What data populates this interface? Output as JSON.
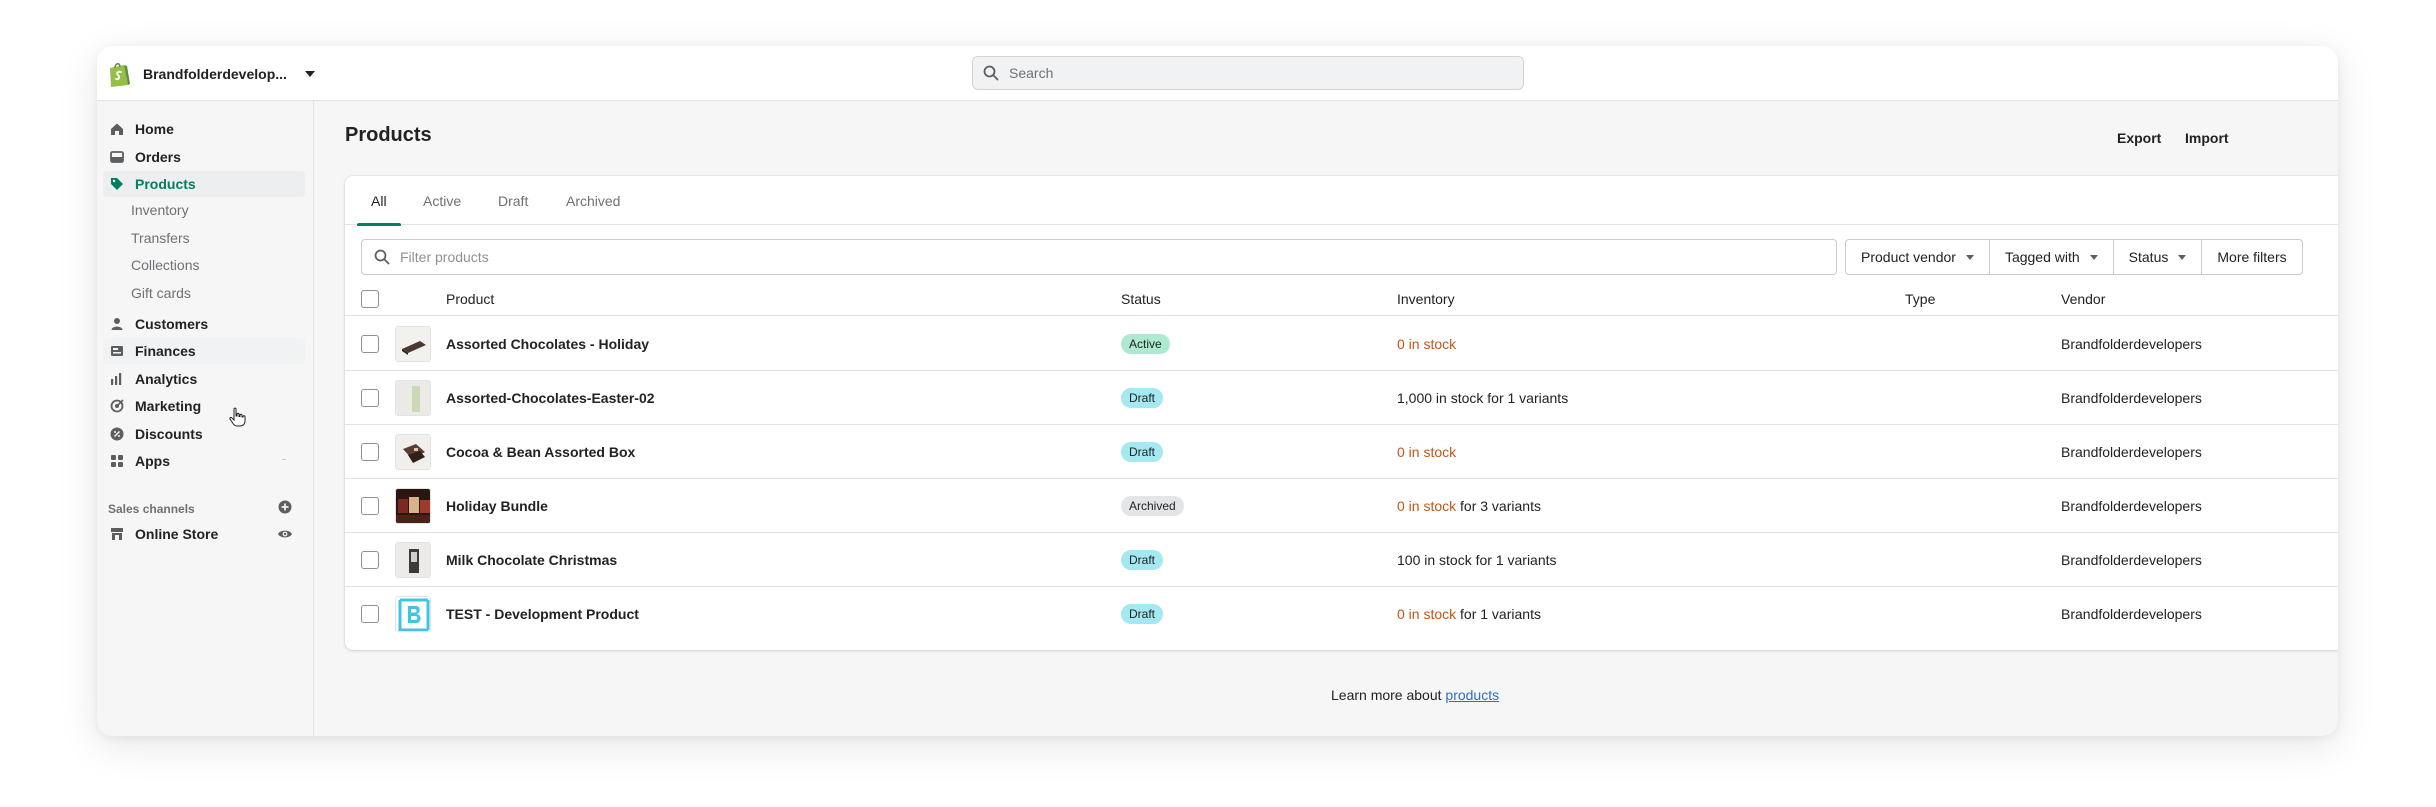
{
  "topbar": {
    "store_name": "Brandfolderdevelop...",
    "search_placeholder": "Search"
  },
  "sidebar": {
    "items": [
      {
        "label": "Home",
        "icon": "home-icon"
      },
      {
        "label": "Orders",
        "icon": "orders-icon"
      },
      {
        "label": "Products",
        "icon": "tag-icon",
        "active": true
      },
      {
        "label": "Customers",
        "icon": "person-icon"
      },
      {
        "label": "Finances",
        "icon": "finances-icon"
      },
      {
        "label": "Analytics",
        "icon": "bar-chart-icon"
      },
      {
        "label": "Marketing",
        "icon": "target-icon"
      },
      {
        "label": "Discounts",
        "icon": "discount-icon"
      },
      {
        "label": "Apps",
        "icon": "apps-icon"
      }
    ],
    "product_subitems": [
      "Inventory",
      "Transfers",
      "Collections",
      "Gift cards"
    ],
    "sales_channels_label": "Sales channels",
    "online_store_label": "Online Store"
  },
  "page": {
    "title": "Products",
    "export_label": "Export",
    "import_label": "Import"
  },
  "tabs": [
    "All",
    "Active",
    "Draft",
    "Archived"
  ],
  "filters": {
    "placeholder": "Filter products",
    "buttons": [
      "Product vendor",
      "Tagged with",
      "Status",
      "More filters"
    ]
  },
  "table": {
    "headers": {
      "product": "Product",
      "status": "Status",
      "inventory": "Inventory",
      "type": "Type",
      "vendor": "Vendor"
    },
    "rows": [
      {
        "name": "Assorted Chocolates - Holiday",
        "status": "Active",
        "inv_warn": "0 in stock",
        "inv_rest": "",
        "vendor": "Brandfolderdevelopers"
      },
      {
        "name": "Assorted-Chocolates-Easter-02",
        "status": "Draft",
        "inv_warn": "",
        "inv_rest": "1,000 in stock for 1 variants",
        "vendor": "Brandfolderdevelopers"
      },
      {
        "name": "Cocoa & Bean Assorted Box",
        "status": "Draft",
        "inv_warn": "0 in stock",
        "inv_rest": "",
        "vendor": "Brandfolderdevelopers"
      },
      {
        "name": "Holiday Bundle",
        "status": "Archived",
        "inv_warn": "0 in stock",
        "inv_rest": " for 3 variants",
        "vendor": "Brandfolderdevelopers"
      },
      {
        "name": "Milk Chocolate Christmas",
        "status": "Draft",
        "inv_warn": "",
        "inv_rest": "100 in stock for 1 variants",
        "vendor": "Brandfolderdevelopers"
      },
      {
        "name": "TEST - Development Product",
        "status": "Draft",
        "inv_warn": "0 in stock",
        "inv_rest": " for 1 variants",
        "vendor": "Brandfolderdevelopers"
      }
    ]
  },
  "footer": {
    "learn_text": "Learn more about ",
    "learn_link": "products"
  },
  "colors": {
    "accent": "#008060",
    "warning_text": "#c05717",
    "link": "#2c6ecb"
  }
}
